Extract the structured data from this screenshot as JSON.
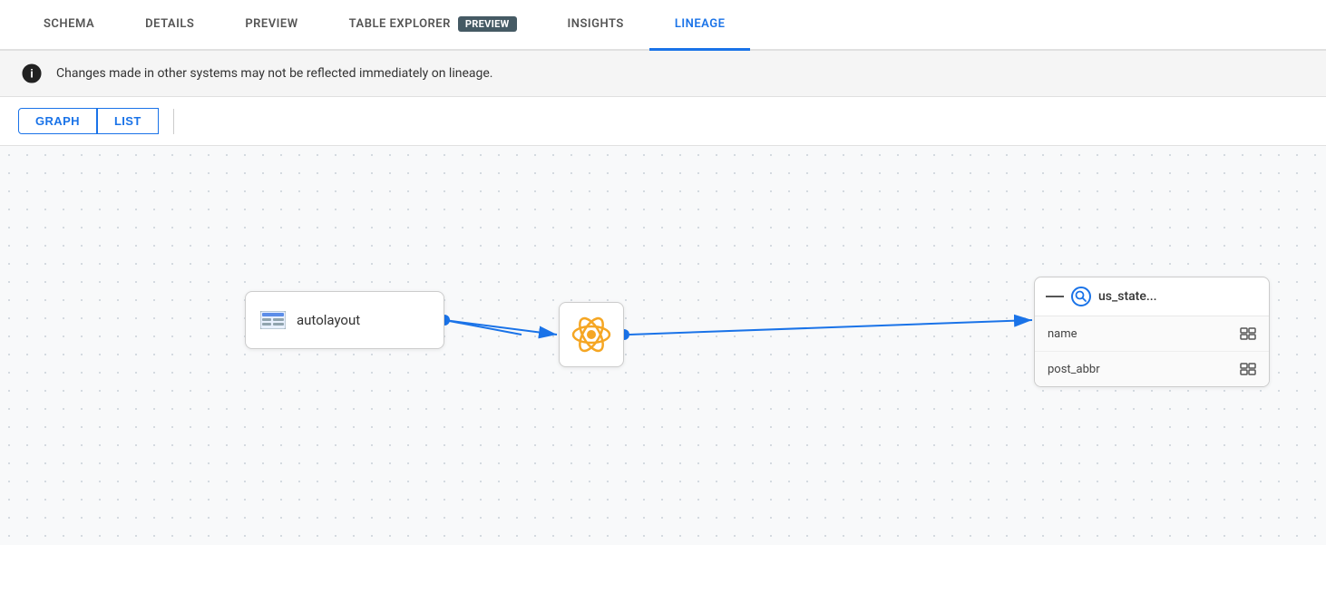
{
  "tabs": [
    {
      "id": "schema",
      "label": "SCHEMA",
      "active": false
    },
    {
      "id": "details",
      "label": "DETAILS",
      "active": false
    },
    {
      "id": "preview",
      "label": "PREVIEW",
      "active": false
    },
    {
      "id": "table-explorer",
      "label": "TABLE EXPLORER",
      "badge": "PREVIEW",
      "active": false
    },
    {
      "id": "insights",
      "label": "INSIGHTS",
      "active": false
    },
    {
      "id": "lineage",
      "label": "LINEAGE",
      "active": true
    }
  ],
  "info_banner": {
    "message": "Changes made in other systems may not be reflected immediately on lineage."
  },
  "graph_controls": {
    "graph_label": "GRAPH",
    "list_label": "LIST"
  },
  "nodes": {
    "autolayout": {
      "label": "autolayout"
    },
    "middle": {},
    "right": {
      "title": "us_state...",
      "fields": [
        {
          "name": "name"
        },
        {
          "name": "post_abbr"
        }
      ]
    }
  }
}
